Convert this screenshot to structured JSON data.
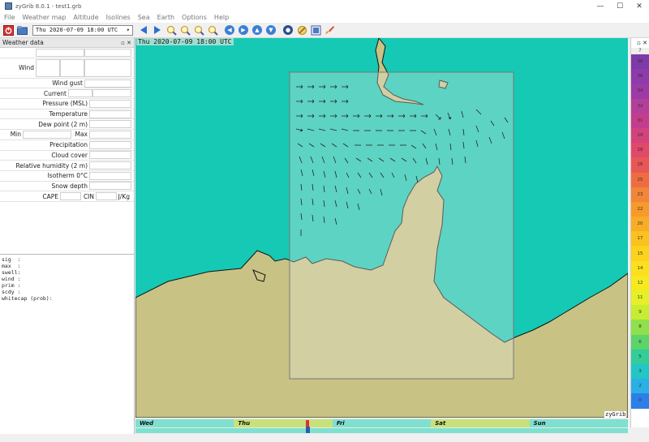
{
  "window": {
    "title": "zyGrib 8.0.1 - test1.grb",
    "controls": [
      "—",
      "☐",
      "✕"
    ]
  },
  "menu": [
    "File",
    "Weather map",
    "Altitude",
    "Isolines",
    "Sea",
    "Earth",
    "Options",
    "Help"
  ],
  "toolbar": {
    "date": "Thu 2020-07-09 18:00 UTC"
  },
  "weather_panel": {
    "title": "Weather data",
    "header_ctrls": "▫ ✕",
    "wind": "Wind",
    "wind_gust": "Wind gust",
    "current": "Current",
    "pressure": "Pressure (MSL)",
    "temperature": "Temperature",
    "dew_point": "Dew point (2 m)",
    "min": "Min",
    "max": "Max",
    "precipitation": "Precipitation",
    "cloud_cover": "Cloud cover",
    "humidity": "Relative humidity (2 m)",
    "isotherm": "Isotherm 0°C",
    "snow_depth": "Snow depth",
    "cape": "CAPE",
    "cin": "CIN",
    "unit": "J/Kg",
    "sea_text": "sig  :\nmax  :\nswell:\nwind :\nprim :\nscdy :\nwhitecap (prob):"
  },
  "map": {
    "date_label": "Thu 2020-07-09 18:00 UTC",
    "brand": "zyGrib"
  },
  "colorbar": {
    "header_ctrls": "▫ ✕",
    "unknown": "?",
    "cells": [
      {
        "label": "38",
        "color": "#7e3aa6"
      },
      {
        "label": "36",
        "color": "#8d3bab"
      },
      {
        "label": "34",
        "color": "#9c3aa7"
      },
      {
        "label": "32",
        "color": "#b33f9b"
      },
      {
        "label": "31",
        "color": "#c43d8c"
      },
      {
        "label": "29",
        "color": "#d4427e"
      },
      {
        "label": "28",
        "color": "#e1486a"
      },
      {
        "label": "26",
        "color": "#e85655"
      },
      {
        "label": "25",
        "color": "#ee6c42"
      },
      {
        "label": "23",
        "color": "#f28537"
      },
      {
        "label": "22",
        "color": "#f69a2c"
      },
      {
        "label": "20",
        "color": "#f8ad24"
      },
      {
        "label": "17",
        "color": "#fac11f"
      },
      {
        "label": "15",
        "color": "#fbd21c"
      },
      {
        "label": "14",
        "color": "#fbe01d"
      },
      {
        "label": "12",
        "color": "#f6ea1f"
      },
      {
        "label": "11",
        "color": "#e6ef27"
      },
      {
        "label": "9",
        "color": "#c8ec30"
      },
      {
        "label": "8",
        "color": "#8fe04b"
      },
      {
        "label": "6",
        "color": "#5bd46a"
      },
      {
        "label": "5",
        "color": "#32cd98"
      },
      {
        "label": "3",
        "color": "#22c6c4"
      },
      {
        "label": "2",
        "color": "#2ab0e4"
      },
      {
        "label": "0",
        "color": "#2d7fe8"
      }
    ]
  },
  "timeline": {
    "days": [
      "Wed",
      "Thu",
      "Fri",
      "Sat",
      "Sun"
    ]
  }
}
